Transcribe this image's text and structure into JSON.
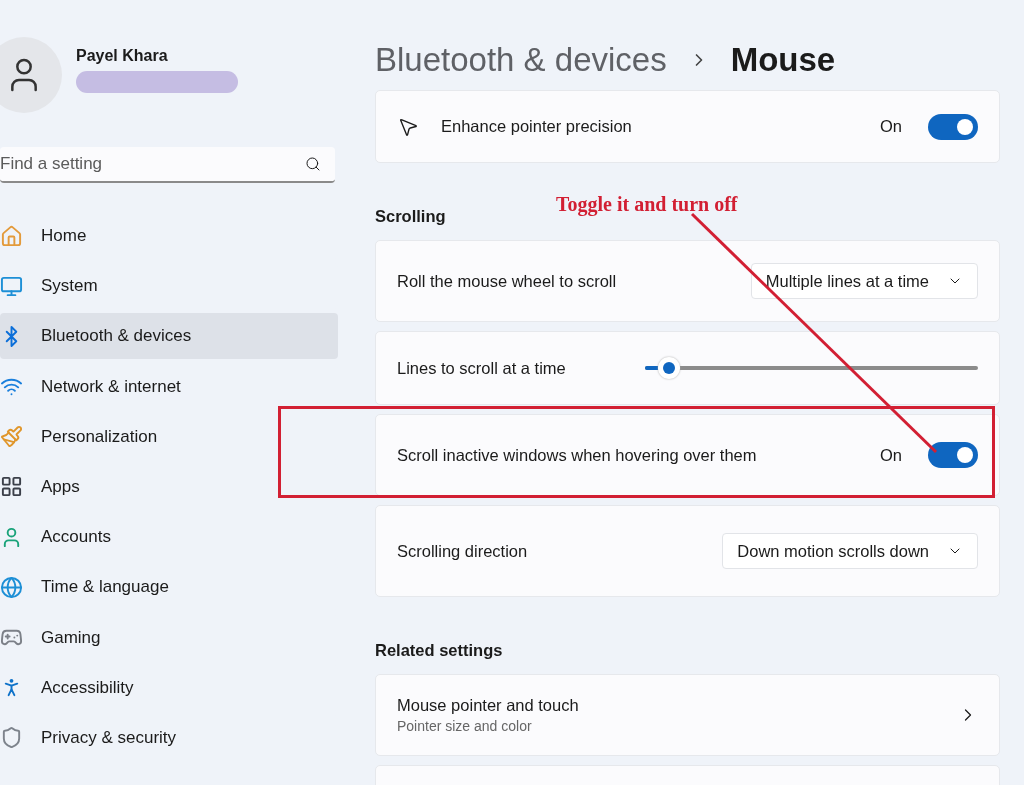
{
  "sidebar": {
    "user": {
      "name": "Payel Khara"
    },
    "search": {
      "placeholder": "Find a setting"
    },
    "nav": [
      {
        "label": "Home",
        "selected": false
      },
      {
        "label": "System",
        "selected": false
      },
      {
        "label": "Bluetooth & devices",
        "selected": true
      },
      {
        "label": "Network & internet",
        "selected": false
      },
      {
        "label": "Personalization",
        "selected": false
      },
      {
        "label": "Apps",
        "selected": false
      },
      {
        "label": "Accounts",
        "selected": false
      },
      {
        "label": "Time & language",
        "selected": false
      },
      {
        "label": "Gaming",
        "selected": false
      },
      {
        "label": "Accessibility",
        "selected": false
      },
      {
        "label": "Privacy & security",
        "selected": false
      }
    ]
  },
  "breadcrumb": {
    "parent": "Bluetooth & devices",
    "current": "Mouse"
  },
  "sections": [
    {
      "rows": [
        {
          "kind": "toggle",
          "label": "Enhance pointer precision",
          "state_text": "On",
          "on": true,
          "highlighted": false
        }
      ]
    },
    {
      "title": "Scrolling",
      "rows": [
        {
          "kind": "dropdown",
          "label": "Roll the mouse wheel to scroll",
          "value": "Multiple lines at a time"
        },
        {
          "kind": "slider",
          "label": "Lines to scroll at a time",
          "level": 0.05
        },
        {
          "kind": "toggle",
          "label": "Scroll inactive windows when hovering over them",
          "state_text": "On",
          "on": true,
          "highlighted": true
        },
        {
          "kind": "dropdown",
          "label": "Scrolling direction",
          "value": "Down motion scrolls down"
        }
      ]
    },
    {
      "title": "Related settings",
      "rows": [
        {
          "kind": "link",
          "label": "Mouse pointer and touch",
          "description": "Pointer size and color"
        },
        {
          "kind": "blank"
        }
      ]
    }
  ],
  "annotation": {
    "text": "Toggle it and turn off"
  }
}
